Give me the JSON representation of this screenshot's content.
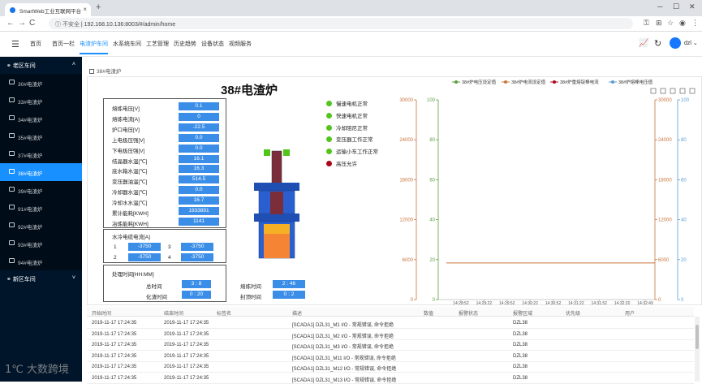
{
  "browser": {
    "tab_title": "SmartWeb工业互联网平台",
    "url_prefix": "不安全",
    "url": "192.168.10.136:8003/#/admin/home"
  },
  "header": {
    "nav": [
      "首页",
      "首页一栏",
      "电渣炉车间",
      "水系统车间",
      "工艺管理",
      "历史趋势",
      "设备状态",
      "视频服务"
    ],
    "active_nav": "电渣炉车间",
    "user": "dzl"
  },
  "sidebar": {
    "group_old": "老区车间",
    "items": [
      "30#电渣炉",
      "33#电渣炉",
      "34#电渣炉",
      "35#电渣炉",
      "37#电渣炉",
      "38#电渣炉",
      "39#电渣炉",
      "91#电渣炉",
      "92#电渣炉",
      "93#电渣炉",
      "94#电渣炉"
    ],
    "active": "38#电渣炉",
    "group_new": "新区车间"
  },
  "breadcrumb": "38#电渣炉",
  "title": "38#电渣炉",
  "readings": [
    {
      "label": "熔炼电压[V]",
      "value": "0.1"
    },
    {
      "label": "熔炼电流[A]",
      "value": "0"
    },
    {
      "label": "炉口电压[V]",
      "value": "-22.5"
    },
    {
      "label": "上电极压强[V]",
      "value": "0.0"
    },
    {
      "label": "下电极压强[V]",
      "value": "0.0"
    },
    {
      "label": "结晶器水温[℃]",
      "value": "16.1"
    },
    {
      "label": "底水箱水温[℃]",
      "value": "16.3"
    },
    {
      "label": "变压器油温[℃]",
      "value": "514.5"
    },
    {
      "label": "冷却器水温[℃]",
      "value": "0.0"
    },
    {
      "label": "冷却水水温[℃]",
      "value": "16.7"
    },
    {
      "label": "累计能耗[KWH]",
      "value": "1933891"
    },
    {
      "label": "冶炼能耗[KWH]",
      "value": "1141"
    }
  ],
  "water": {
    "title": "水冷电缆电流[A]",
    "items": [
      {
        "n": "1",
        "value": "-3750"
      },
      {
        "n": "3",
        "value": "-3750"
      },
      {
        "n": "2",
        "value": "-3750"
      },
      {
        "n": "4",
        "value": "-3750"
      }
    ]
  },
  "times": {
    "title": "处理时间[HH:MM]",
    "total_label": "总时间",
    "total_value": "3 : 8",
    "melt_label": "熔炼时间",
    "melt_value": "2 : 46",
    "slag_label": "化渣时间",
    "slag_value": "0 : 20",
    "cap_label": "封顶时间",
    "cap_value": "0 : 2"
  },
  "status": [
    {
      "label": "慢速电机正常",
      "color": "#52c41a"
    },
    {
      "label": "快速电机正常",
      "color": "#52c41a"
    },
    {
      "label": "冷却阻尼正常",
      "color": "#52c41a"
    },
    {
      "label": "变压器工作正常",
      "color": "#52c41a"
    },
    {
      "label": "运输小车工作正常",
      "color": "#52c41a"
    },
    {
      "label": "高压允许",
      "color": "#a8071a"
    }
  ],
  "chart_data": {
    "type": "line",
    "legend_position": "top-right",
    "series": [
      {
        "name": "38#炉电压设定值",
        "color": "#5d9e3e",
        "axis": "left-1",
        "values": []
      },
      {
        "name": "38#炉电流设定值",
        "color": "#c8743c",
        "axis": "left-0",
        "values": [
          5500,
          5500,
          5500,
          5500,
          5500,
          5500,
          5500,
          5500,
          5500,
          5500
        ]
      },
      {
        "name": "38#炉重熔锭棒电流",
        "color": "#a8071a",
        "axis": "right-0",
        "values": []
      },
      {
        "name": "38#炉熔棒电压值",
        "color": "#5b9bd5",
        "axis": "right-1",
        "values": []
      }
    ],
    "x": [
      "14:28:52",
      "14:29:22",
      "14:29:52",
      "14:30:22",
      "14:30:52",
      "14:31:22",
      "14:31:52",
      "14:32:20",
      "14:32:49"
    ],
    "left_axis_0": {
      "ticks": [
        "30000",
        "24000",
        "18000",
        "12000",
        "6000",
        "0"
      ],
      "ylim": [
        0,
        30000
      ]
    },
    "left_axis_1": {
      "ticks": [
        "100",
        "80",
        "60",
        "40",
        "20",
        "0"
      ],
      "ylim": [
        0,
        100
      ]
    },
    "right_axis_0": {
      "ticks": [
        "30000",
        "24000",
        "18000",
        "12000",
        "6000",
        "0"
      ],
      "ylim": [
        0,
        30000
      ]
    },
    "right_axis_1": {
      "ticks": [
        "100",
        "80",
        "60",
        "40",
        "20",
        "0"
      ],
      "ylim": [
        0,
        100
      ]
    },
    "grid": false
  },
  "table": {
    "headers": [
      "开始时间",
      "结束时间",
      "标签名",
      "描述",
      "数值",
      "报警状态",
      "报警区域",
      "优先级",
      "用户"
    ],
    "rows": [
      [
        "2019-11-17 17:24:35",
        "2019-11-17 17:24:35",
        "",
        "[SCADA1] DZL31_M1 I/O - 常规错误, 命令拒绝",
        "",
        "",
        "DZL38",
        "",
        ""
      ],
      [
        "2019-11-17 17:24:35",
        "2019-11-17 17:24:35",
        "",
        "[SCADA1] DZL31_M2 I/O - 常规错误, 命令拒绝",
        "",
        "",
        "DZL38",
        "",
        ""
      ],
      [
        "2019-11-17 17:24:35",
        "2019-11-17 17:24:35",
        "",
        "[SCADA1] DZL31_M3 I/O - 常规错误, 命令拒绝",
        "",
        "",
        "DZL38",
        "",
        ""
      ],
      [
        "2019-11-17 17:24:35",
        "2019-11-17 17:24:35",
        "",
        "[SCADA1] DZL31_M11 I/O - 常规错误, 命令拒绝",
        "",
        "",
        "DZL38",
        "",
        ""
      ],
      [
        "2019-11-17 17:24:35",
        "2019-11-17 17:24:35",
        "",
        "[SCADA1] DZL31_M12 I/O - 常规错误, 命令拒绝",
        "",
        "",
        "DZL38",
        "",
        ""
      ],
      [
        "2019-11-17 17:24:35",
        "2019-11-17 17:24:35",
        "",
        "[SCADA1] DZL31_M13 I/O - 常规错误, 命令拒绝",
        "",
        "",
        "DZL38",
        "",
        ""
      ]
    ]
  },
  "watermark": "大数跨境"
}
